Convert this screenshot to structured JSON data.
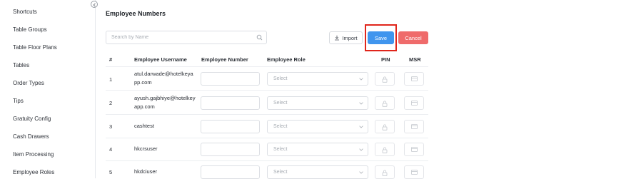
{
  "sidebar": {
    "items": [
      {
        "label": "Shortcuts"
      },
      {
        "label": "Table Groups"
      },
      {
        "label": "Table Floor Plans"
      },
      {
        "label": "Tables"
      },
      {
        "label": "Order Types"
      },
      {
        "label": "Tips"
      },
      {
        "label": "Gratuity Config"
      },
      {
        "label": "Cash Drawers"
      },
      {
        "label": "Item Processing"
      },
      {
        "label": "Employee Roles"
      }
    ]
  },
  "page": {
    "title": "Employee Numbers"
  },
  "toolbar": {
    "search_placeholder": "Search by Name",
    "import_label": "Import",
    "save_label": "Save",
    "cancel_label": "Cancel"
  },
  "colors": {
    "save": "#3f95ee",
    "cancel": "#ef6b6b",
    "highlight": "#e0251b"
  },
  "table": {
    "columns": {
      "num": "#",
      "username": "Employee Username",
      "number": "Employee Number",
      "role": "Employee Role",
      "pin": "PIN",
      "msr": "MSR"
    },
    "role_placeholder": "Select",
    "rows": [
      {
        "num": "1",
        "username": "atul.darwade@hotelkeyapp.com",
        "number": "",
        "role": "Select"
      },
      {
        "num": "2",
        "username": "ayush.gajbhiye@hotelkeyapp.com",
        "number": "",
        "role": "Select"
      },
      {
        "num": "3",
        "username": "cashtest",
        "number": "",
        "role": "Select"
      },
      {
        "num": "4",
        "username": "hkcrsuser",
        "number": "",
        "role": "Select"
      },
      {
        "num": "5",
        "username": "hkdciuser",
        "number": "",
        "role": "Select"
      }
    ]
  }
}
